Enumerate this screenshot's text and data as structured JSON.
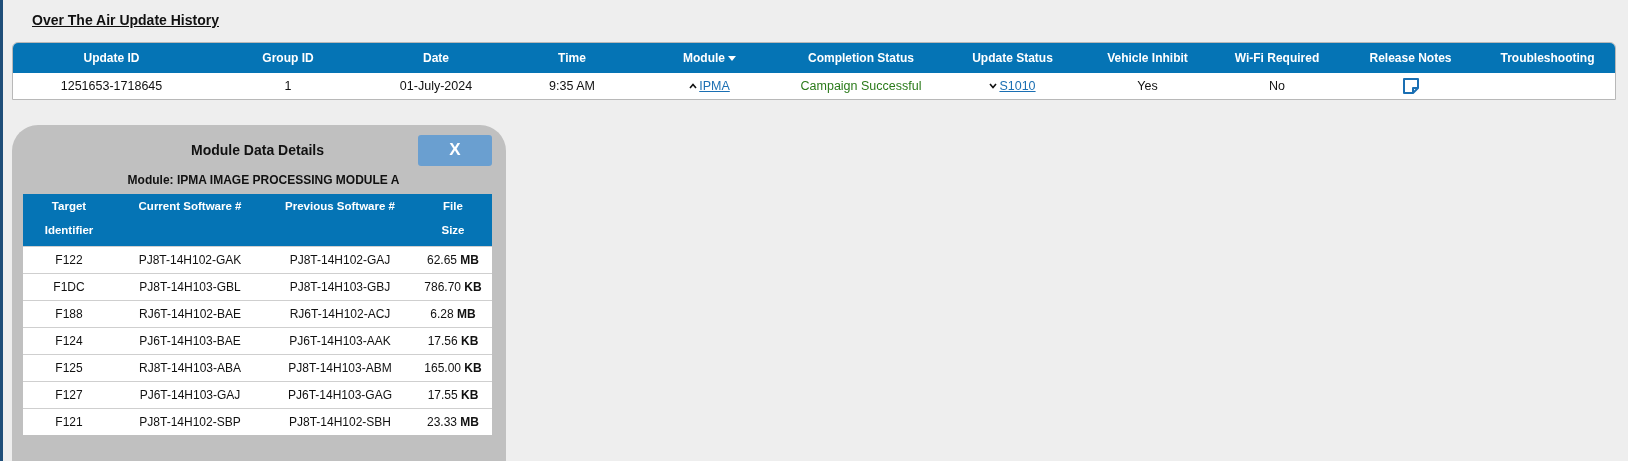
{
  "page_title": "Over The Air Update History",
  "history_table": {
    "columns": [
      {
        "label": "Update ID"
      },
      {
        "label": "Group ID"
      },
      {
        "label": "Date"
      },
      {
        "label": "Time"
      },
      {
        "label": "Module",
        "sorted": true
      },
      {
        "label": "Completion Status"
      },
      {
        "label": "Update Status"
      },
      {
        "label": "Vehicle Inhibit"
      },
      {
        "label": "Wi-Fi Required"
      },
      {
        "label": "Release Notes"
      },
      {
        "label": "Troubleshooting"
      }
    ],
    "rows": [
      {
        "update_id": "1251653-1718645",
        "group_id": "1",
        "date": "01-July-2024",
        "time": "9:35 AM",
        "module": {
          "text": "IPMA",
          "expanded": true
        },
        "completion_status": "Campaign Successful",
        "update_status": {
          "text": "S1010",
          "expanded": false
        },
        "vehicle_inhibit": "Yes",
        "wifi_required": "No",
        "release_notes": {
          "kind": "note"
        }
      }
    ]
  },
  "module_dialog": {
    "title": "Module Data Details",
    "close_label": "X",
    "module_label": "Module: IPMA IMAGE PROCESSING MODULE A",
    "columns": [
      "Target Identifier",
      "Current Software #",
      "Previous Software #",
      "File Size"
    ],
    "rows": [
      [
        "F122",
        "PJ8T-14H102-GAK",
        "PJ8T-14H102-GAJ",
        "62.65 **MB**"
      ],
      [
        "F1DC",
        "PJ8T-14H103-GBL",
        "PJ8T-14H103-GBJ",
        "786.70 **KB**"
      ],
      [
        "F188",
        "RJ6T-14H102-BAE",
        "RJ6T-14H102-ACJ",
        "6.28 **MB**"
      ],
      [
        "F124",
        "PJ6T-14H103-BAE",
        "PJ6T-14H103-AAK",
        "17.56 **KB**"
      ],
      [
        "F125",
        "RJ8T-14H103-ABA",
        "PJ8T-14H103-ABM",
        "165.00 **KB**"
      ],
      [
        "F127",
        "PJ6T-14H103-GAJ",
        "PJ6T-14H103-GAG",
        "17.55 **KB**"
      ],
      [
        "F121",
        "PJ8T-14H102-SBP",
        "PJ8T-14H102-SBH",
        "23.33 **MB**"
      ]
    ]
  }
}
